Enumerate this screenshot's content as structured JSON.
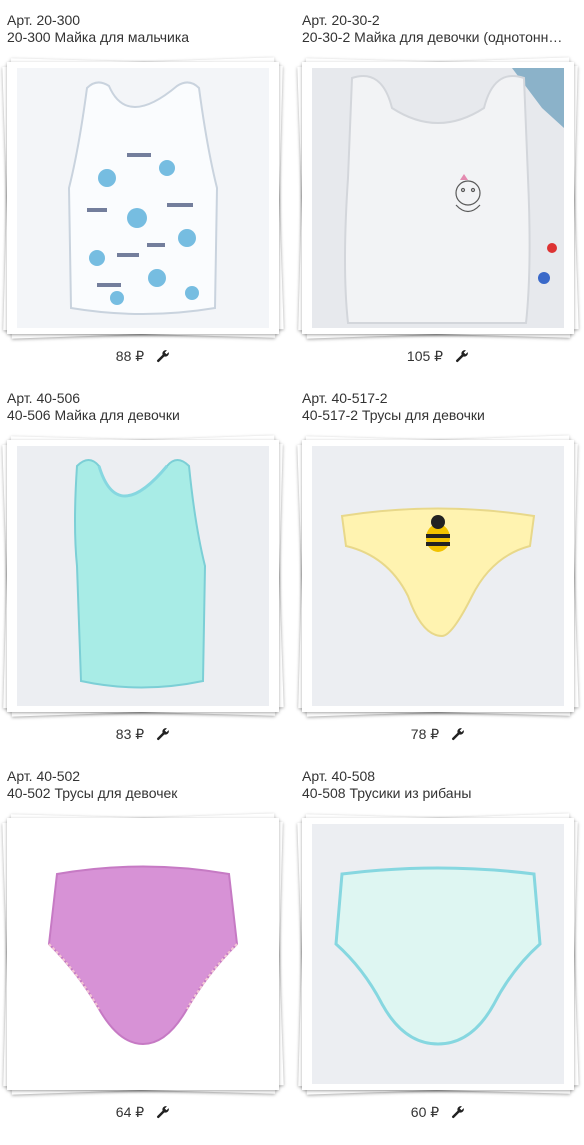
{
  "currency": "₽",
  "products": [
    {
      "art": "Арт. 20-300",
      "title": "20-300 Майка для мальчика",
      "price": "88",
      "image": "white-tank-print",
      "colors": {
        "garment": "#f4f6f9",
        "print": "#4aa8d8"
      }
    },
    {
      "art": "Арт. 20-30-2",
      "title": "20-30-2 Майка для девочки (однотонн…",
      "price": "105",
      "image": "grey-tank-embroidery",
      "colors": {
        "garment": "#e8e9ec"
      }
    },
    {
      "art": "Арт. 40-506",
      "title": "40-506 Майка для девочки",
      "price": "83",
      "image": "mint-tank",
      "colors": {
        "garment": "#a8ece6"
      }
    },
    {
      "art": "Арт. 40-517-2",
      "title": "40-517-2 Трусы для девочки",
      "price": "78",
      "image": "yellow-briefs-bee",
      "colors": {
        "garment": "#fff3b0"
      }
    },
    {
      "art": "Арт. 40-502",
      "title": "40-502 Трусы для девочек",
      "price": "64",
      "image": "pink-briefs",
      "colors": {
        "garment": "#d792d6"
      }
    },
    {
      "art": "Арт. 40-508",
      "title": "40-508 Трусики из рибаны",
      "price": "60",
      "image": "mint-briefs",
      "colors": {
        "garment": "#def6f2"
      }
    }
  ],
  "icons": {
    "edit": "wrench-icon"
  }
}
